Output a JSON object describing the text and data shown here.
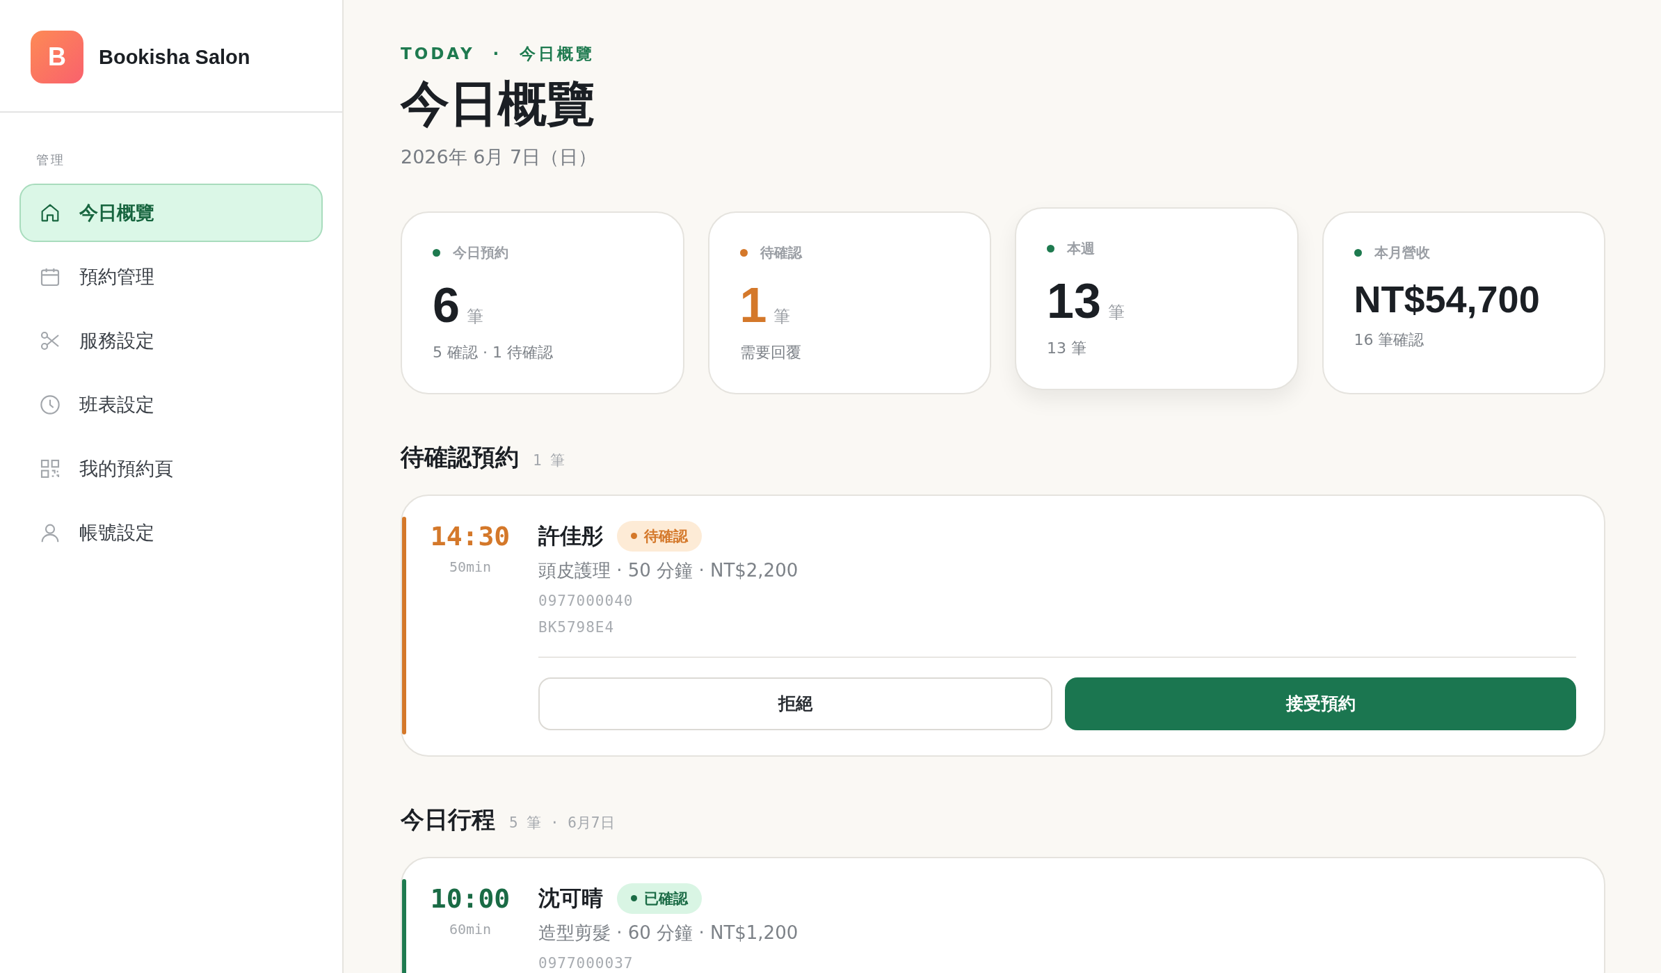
{
  "sidebar": {
    "brand": {
      "logo": "B",
      "name": "Bookisha Salon"
    },
    "section_label": "管理",
    "items": [
      {
        "label": "今日概覽",
        "kind": "home",
        "selected": true
      },
      {
        "label": "預約管理",
        "kind": "calendar",
        "selected": false
      },
      {
        "label": "服務設定",
        "kind": "scissors",
        "selected": false
      },
      {
        "label": "班表設定",
        "kind": "clock",
        "selected": false
      },
      {
        "label": "我的預約頁",
        "kind": "qr",
        "selected": false
      },
      {
        "label": "帳號設定",
        "kind": "user",
        "selected": false
      }
    ]
  },
  "header": {
    "eyebrow": "TODAY · 今日概覽",
    "title": "今日概覽",
    "date": "2026年 6月 7日（日）"
  },
  "stats": [
    {
      "label": "今日預約",
      "color": "#1e7a4f",
      "value": "6",
      "unit": "筆",
      "note": "5 確認 · 1 待確認",
      "highlight": false,
      "hovered": false
    },
    {
      "label": "待確認",
      "color": "#d4782a",
      "value": "1",
      "unit": "筆",
      "note": "需要回覆",
      "highlight": true,
      "hovered": false
    },
    {
      "label": "本週",
      "color": "#1e7a4f",
      "value": "13",
      "unit": "筆",
      "note": "13 筆",
      "highlight": false,
      "hovered": true
    },
    {
      "label": "本月營收",
      "color": "#1e7a4f",
      "value": "NT$54,700",
      "note": "16 筆確認",
      "highlight": false,
      "hovered": false
    }
  ],
  "sections": [
    {
      "title": "待確認預約",
      "meta": "1 筆",
      "bookings": [
        {
          "time": "14:30",
          "duration": "50min",
          "name": "許佳彤",
          "status": "待確認",
          "kind": "pending",
          "details": "頭皮護理 · 50 分鐘 · NT$2,200",
          "phone": "0977000040",
          "code": "BK5798E4",
          "actions": [
            "拒絕",
            "接受預約"
          ]
        }
      ]
    },
    {
      "title": "今日行程",
      "meta": "5 筆 · 6月7日",
      "bookings": [
        {
          "time": "10:00",
          "duration": "60min",
          "name": "沈可晴",
          "status": "已確認",
          "kind": "confirmed",
          "details": "造型剪髮 · 60 分鐘 · NT$1,200",
          "phone": "0977000037"
        }
      ]
    }
  ]
}
